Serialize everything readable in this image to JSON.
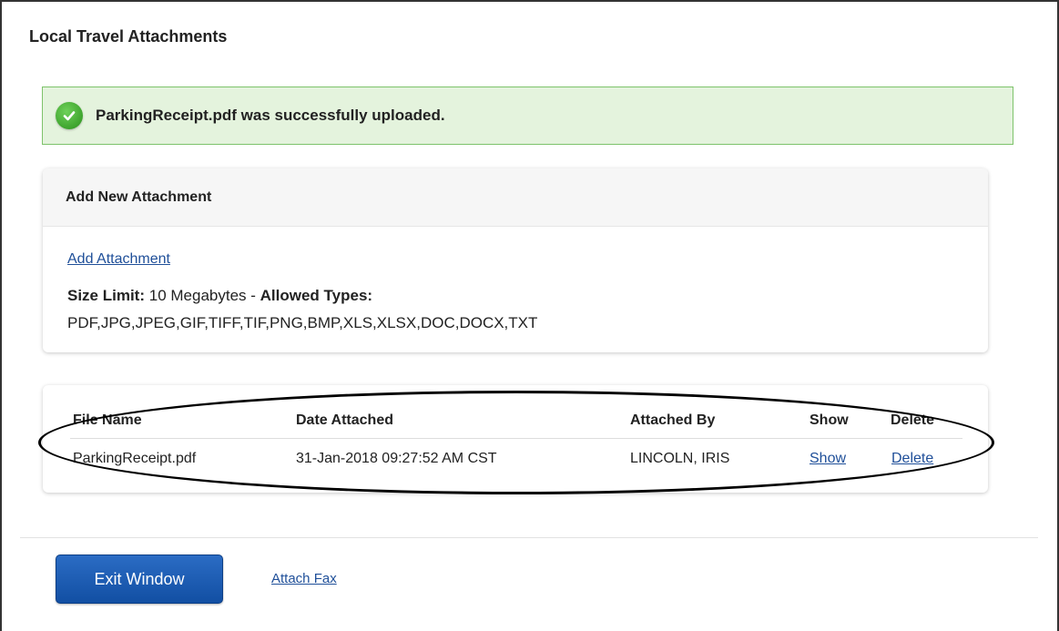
{
  "page": {
    "title": "Local Travel Attachments"
  },
  "alert": {
    "icon": "check-circle-icon",
    "message": "ParkingReceipt.pdf was successfully uploaded.",
    "bg_color": "#e4f3dd",
    "border_color": "#7ec36b"
  },
  "add_section": {
    "header": "Add New Attachment",
    "add_link": "Add Attachment",
    "size_limit_label": "Size Limit:",
    "size_limit_value": " 10 Megabytes - ",
    "allowed_types_label": "Allowed Types:",
    "allowed_types": "PDF,JPG,JPEG,GIF,TIFF,TIF,PNG,BMP,XLS,XLSX,DOC,DOCX,TXT"
  },
  "attachments_table": {
    "columns": [
      "File Name",
      "Date Attached",
      "Attached By",
      "Show",
      "Delete"
    ],
    "rows": [
      {
        "file_name": "ParkingReceipt.pdf",
        "date_attached": "31-Jan-2018 09:27:52 AM CST",
        "attached_by": "LINCOLN, IRIS",
        "show": "Show",
        "delete": "Delete"
      }
    ]
  },
  "footer": {
    "exit_button": "Exit Window",
    "attach_fax_link": "Attach Fax",
    "button_color": "#1a5cb3"
  }
}
